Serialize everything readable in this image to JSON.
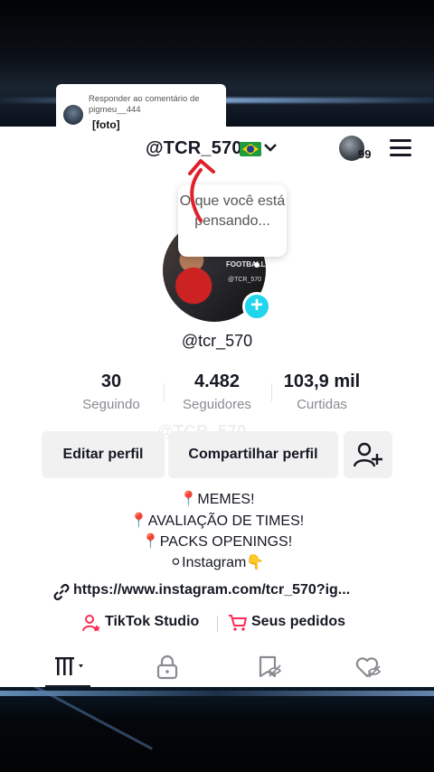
{
  "reply": {
    "title": "Responder ao comentário de pigmeu__444",
    "body": "[foto]"
  },
  "header": {
    "username": "@TCR_570",
    "badge": "99",
    "flag_icon": "brazil-flag-icon",
    "chevron_icon": "chevron-down-icon",
    "menu_icon": "hamburger-menu-icon"
  },
  "avatar": {
    "thought": "O que você está pensando...",
    "overlay_line1": "FOOTBALL",
    "overlay_line2": "@TCR_570"
  },
  "profile": {
    "handle": "@tcr_570",
    "watermark": "@TCR_570"
  },
  "stats": [
    {
      "num": "30",
      "label": "Seguindo"
    },
    {
      "num": "4.482",
      "label": "Seguidores"
    },
    {
      "num": "103,9 mil",
      "label": "Curtidas"
    }
  ],
  "buttons": {
    "edit": "Editar perfil",
    "share": "Compartilhar perfil"
  },
  "bio": {
    "line1": "MEMES!",
    "line2": "AVALIAÇÃO DE TIMES!",
    "line3": "PACKS OPENINGS!",
    "line4": "Instagram👇"
  },
  "link": "https://www.instagram.com/tcr_570?ig...",
  "shortcuts": {
    "studio": "TikTok Studio",
    "orders": "Seus pedidos"
  },
  "colors": {
    "accent_pink": "#fe2c55",
    "plus_cyan": "#20d5ec",
    "text": "#161823",
    "muted": "#8a8b91"
  }
}
